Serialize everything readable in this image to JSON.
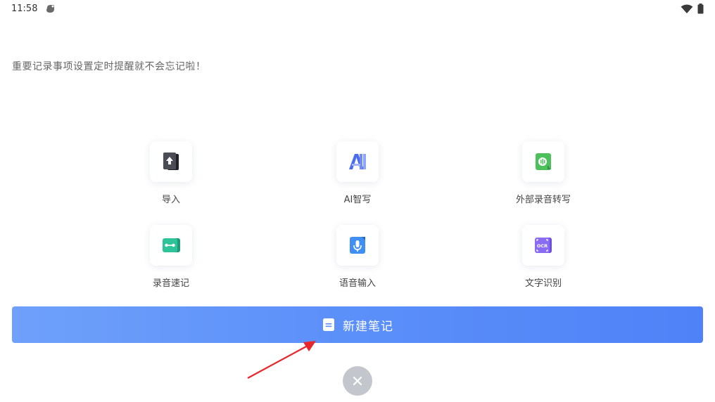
{
  "status_bar": {
    "time": "11:58",
    "icons": [
      "app-notification-icon",
      "wifi-icon",
      "battery-icon"
    ]
  },
  "hint": {
    "text": "重要记录事项设置定时提醒就不会忘记啦！"
  },
  "tools": [
    {
      "id": "import",
      "label": "导入",
      "icon": "import-icon",
      "color": "#3d4048"
    },
    {
      "id": "ai-write",
      "label": "AI智写",
      "icon": "ai-write-icon",
      "color": "#4b6cf0"
    },
    {
      "id": "external-transcribe",
      "label": "外部录音转写",
      "icon": "audio-transcribe-icon",
      "color": "#4cc05a"
    },
    {
      "id": "quick-record",
      "label": "录音速记",
      "icon": "recording-icon",
      "color": "#2fc39a"
    },
    {
      "id": "voice-input",
      "label": "语音输入",
      "icon": "microphone-icon",
      "color": "#3f8ff5"
    },
    {
      "id": "ocr",
      "label": "文字识别",
      "icon": "ocr-icon",
      "color": "#8a6cf2"
    }
  ],
  "new_note": {
    "label": "新建笔记",
    "icon": "note-icon"
  },
  "close": {
    "icon": "close-icon"
  },
  "colors": {
    "button_gradient_start": "#6fa0fb",
    "button_gradient_end": "#4f82f7",
    "annotation_arrow": "#e8262b"
  }
}
